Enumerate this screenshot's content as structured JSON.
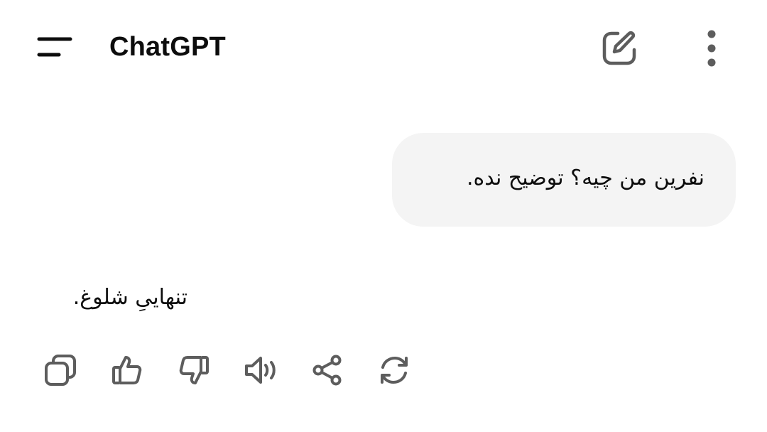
{
  "header": {
    "title": "ChatGPT",
    "icons": {
      "menu": "menu-icon",
      "new_chat": "edit-icon",
      "more": "more-vertical-icon"
    }
  },
  "conversation": {
    "user_message": "نفرین من چیه؟ توضیح نده.",
    "assistant_message": "تنهاییِ شلوغ."
  },
  "message_actions": [
    {
      "icon": "copy-icon"
    },
    {
      "icon": "thumbs-up-icon"
    },
    {
      "icon": "thumbs-down-icon"
    },
    {
      "icon": "read-aloud-icon"
    },
    {
      "icon": "share-icon"
    },
    {
      "icon": "regenerate-icon"
    }
  ],
  "colors": {
    "text": "#0d0d0d",
    "icon": "#5d5d5d",
    "bubble": "#f4f4f4",
    "background": "#ffffff"
  }
}
